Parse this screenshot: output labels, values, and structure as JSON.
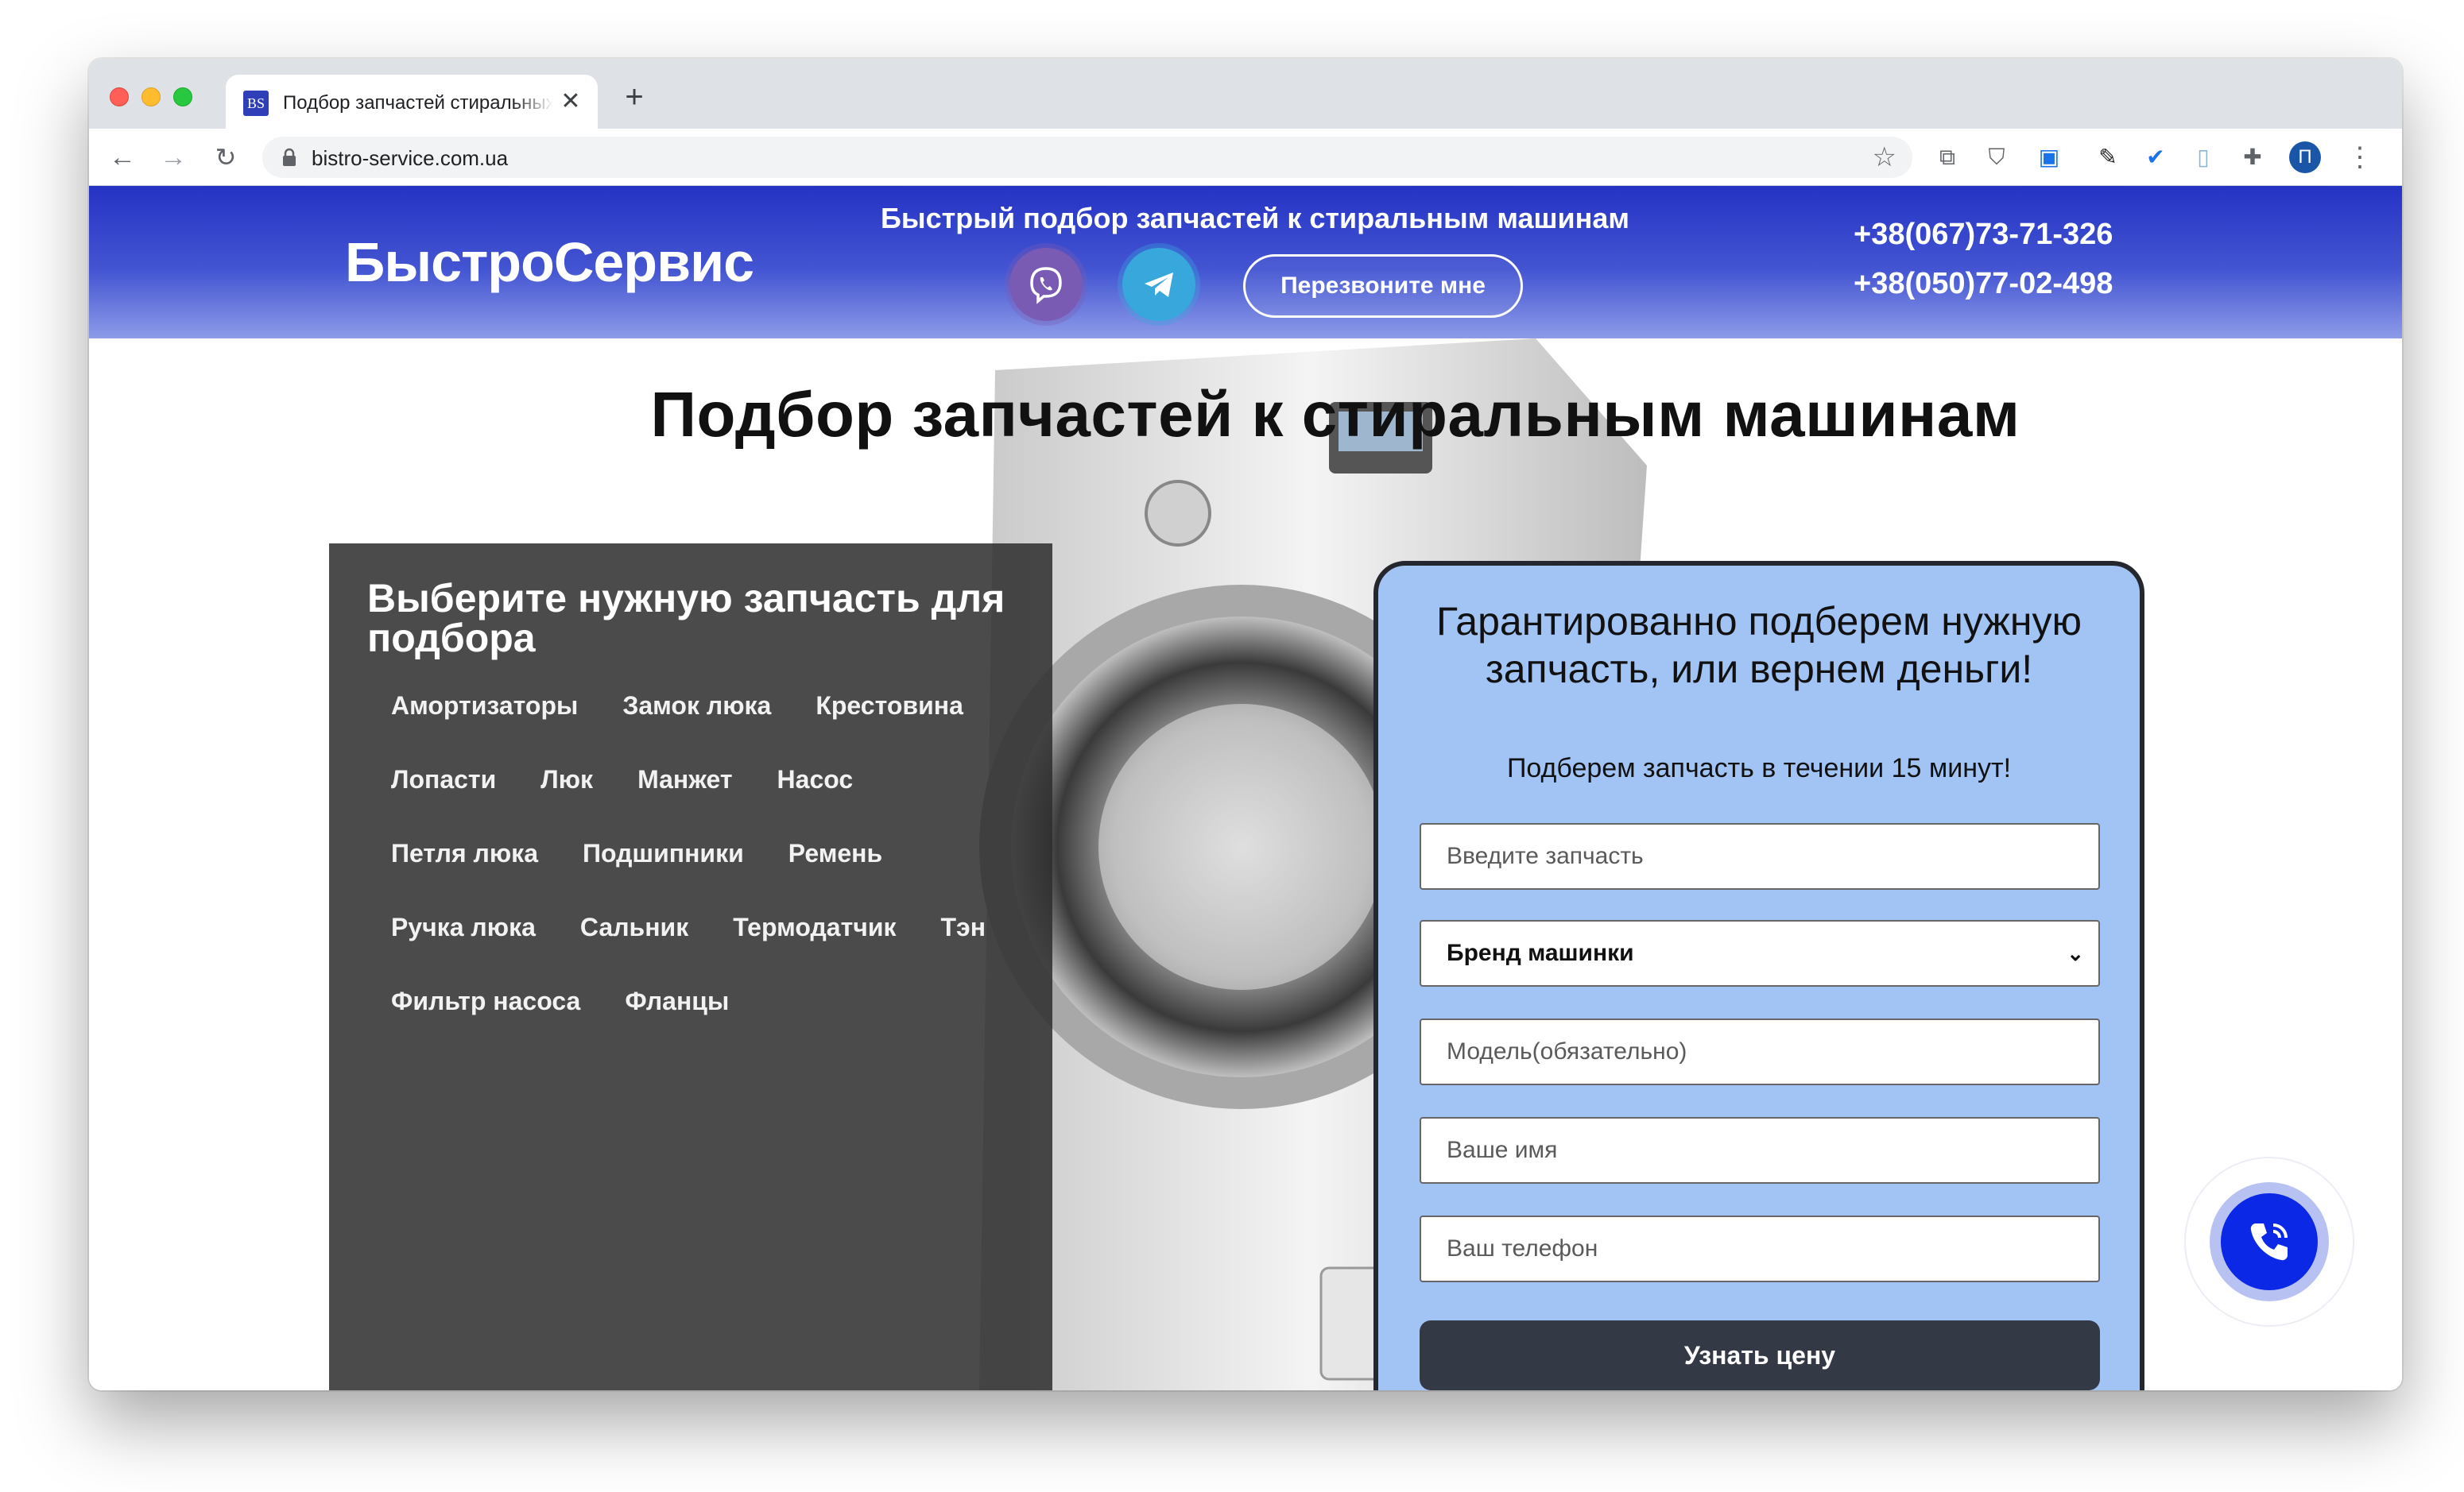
{
  "browser": {
    "tab_title": "Подбор запчастей стиральных машин",
    "tab_favicon_text": "BS",
    "tab_close": "✕",
    "new_tab": "+",
    "url": "bistro-service.com.ua",
    "profile_initial": "П"
  },
  "header": {
    "logo": "БыстроСервис",
    "tagline": "Быстрый подбор запчастей к стиральным машинам",
    "callback_button": "Перезвоните мне",
    "phones": [
      "+38(067)73-71-326",
      "+38(050)77-02-498"
    ]
  },
  "main": {
    "title": "Подбор запчастей к стиральным машинам"
  },
  "parts_panel": {
    "heading": "Выберите нужную запчасть для подбора",
    "rows": [
      [
        "Амортизаторы",
        "Замок люка",
        "Крестовина"
      ],
      [
        "Лопасти",
        "Люк",
        "Манжет",
        "Насос"
      ],
      [
        "Петля люка",
        "Подшипники",
        "Ремень"
      ],
      [
        "Ручка люка",
        "Сальник",
        "Термодатчик",
        "Тэн"
      ],
      [
        "Фильтр насоса",
        "Фланцы"
      ]
    ]
  },
  "form": {
    "title": "Гарантированно подберем нужную запчасть, или вернем деньги!",
    "subtitle": "Подберем запчасть в течении 15 минут!",
    "part_placeholder": "Введите запчасть",
    "brand_selected": "Бренд машинки",
    "model_placeholder": "Модель(обязательно)",
    "name_placeholder": "Ваше имя",
    "phone_placeholder": "Ваш телефон",
    "submit": "Узнать цену"
  },
  "colors": {
    "header_gradient_top": "#2533c4",
    "header_gradient_bottom": "#8d9be8",
    "form_bg": "#a2c4f5",
    "submit_bg": "#343a45",
    "call_widget": "#0a28e6"
  }
}
